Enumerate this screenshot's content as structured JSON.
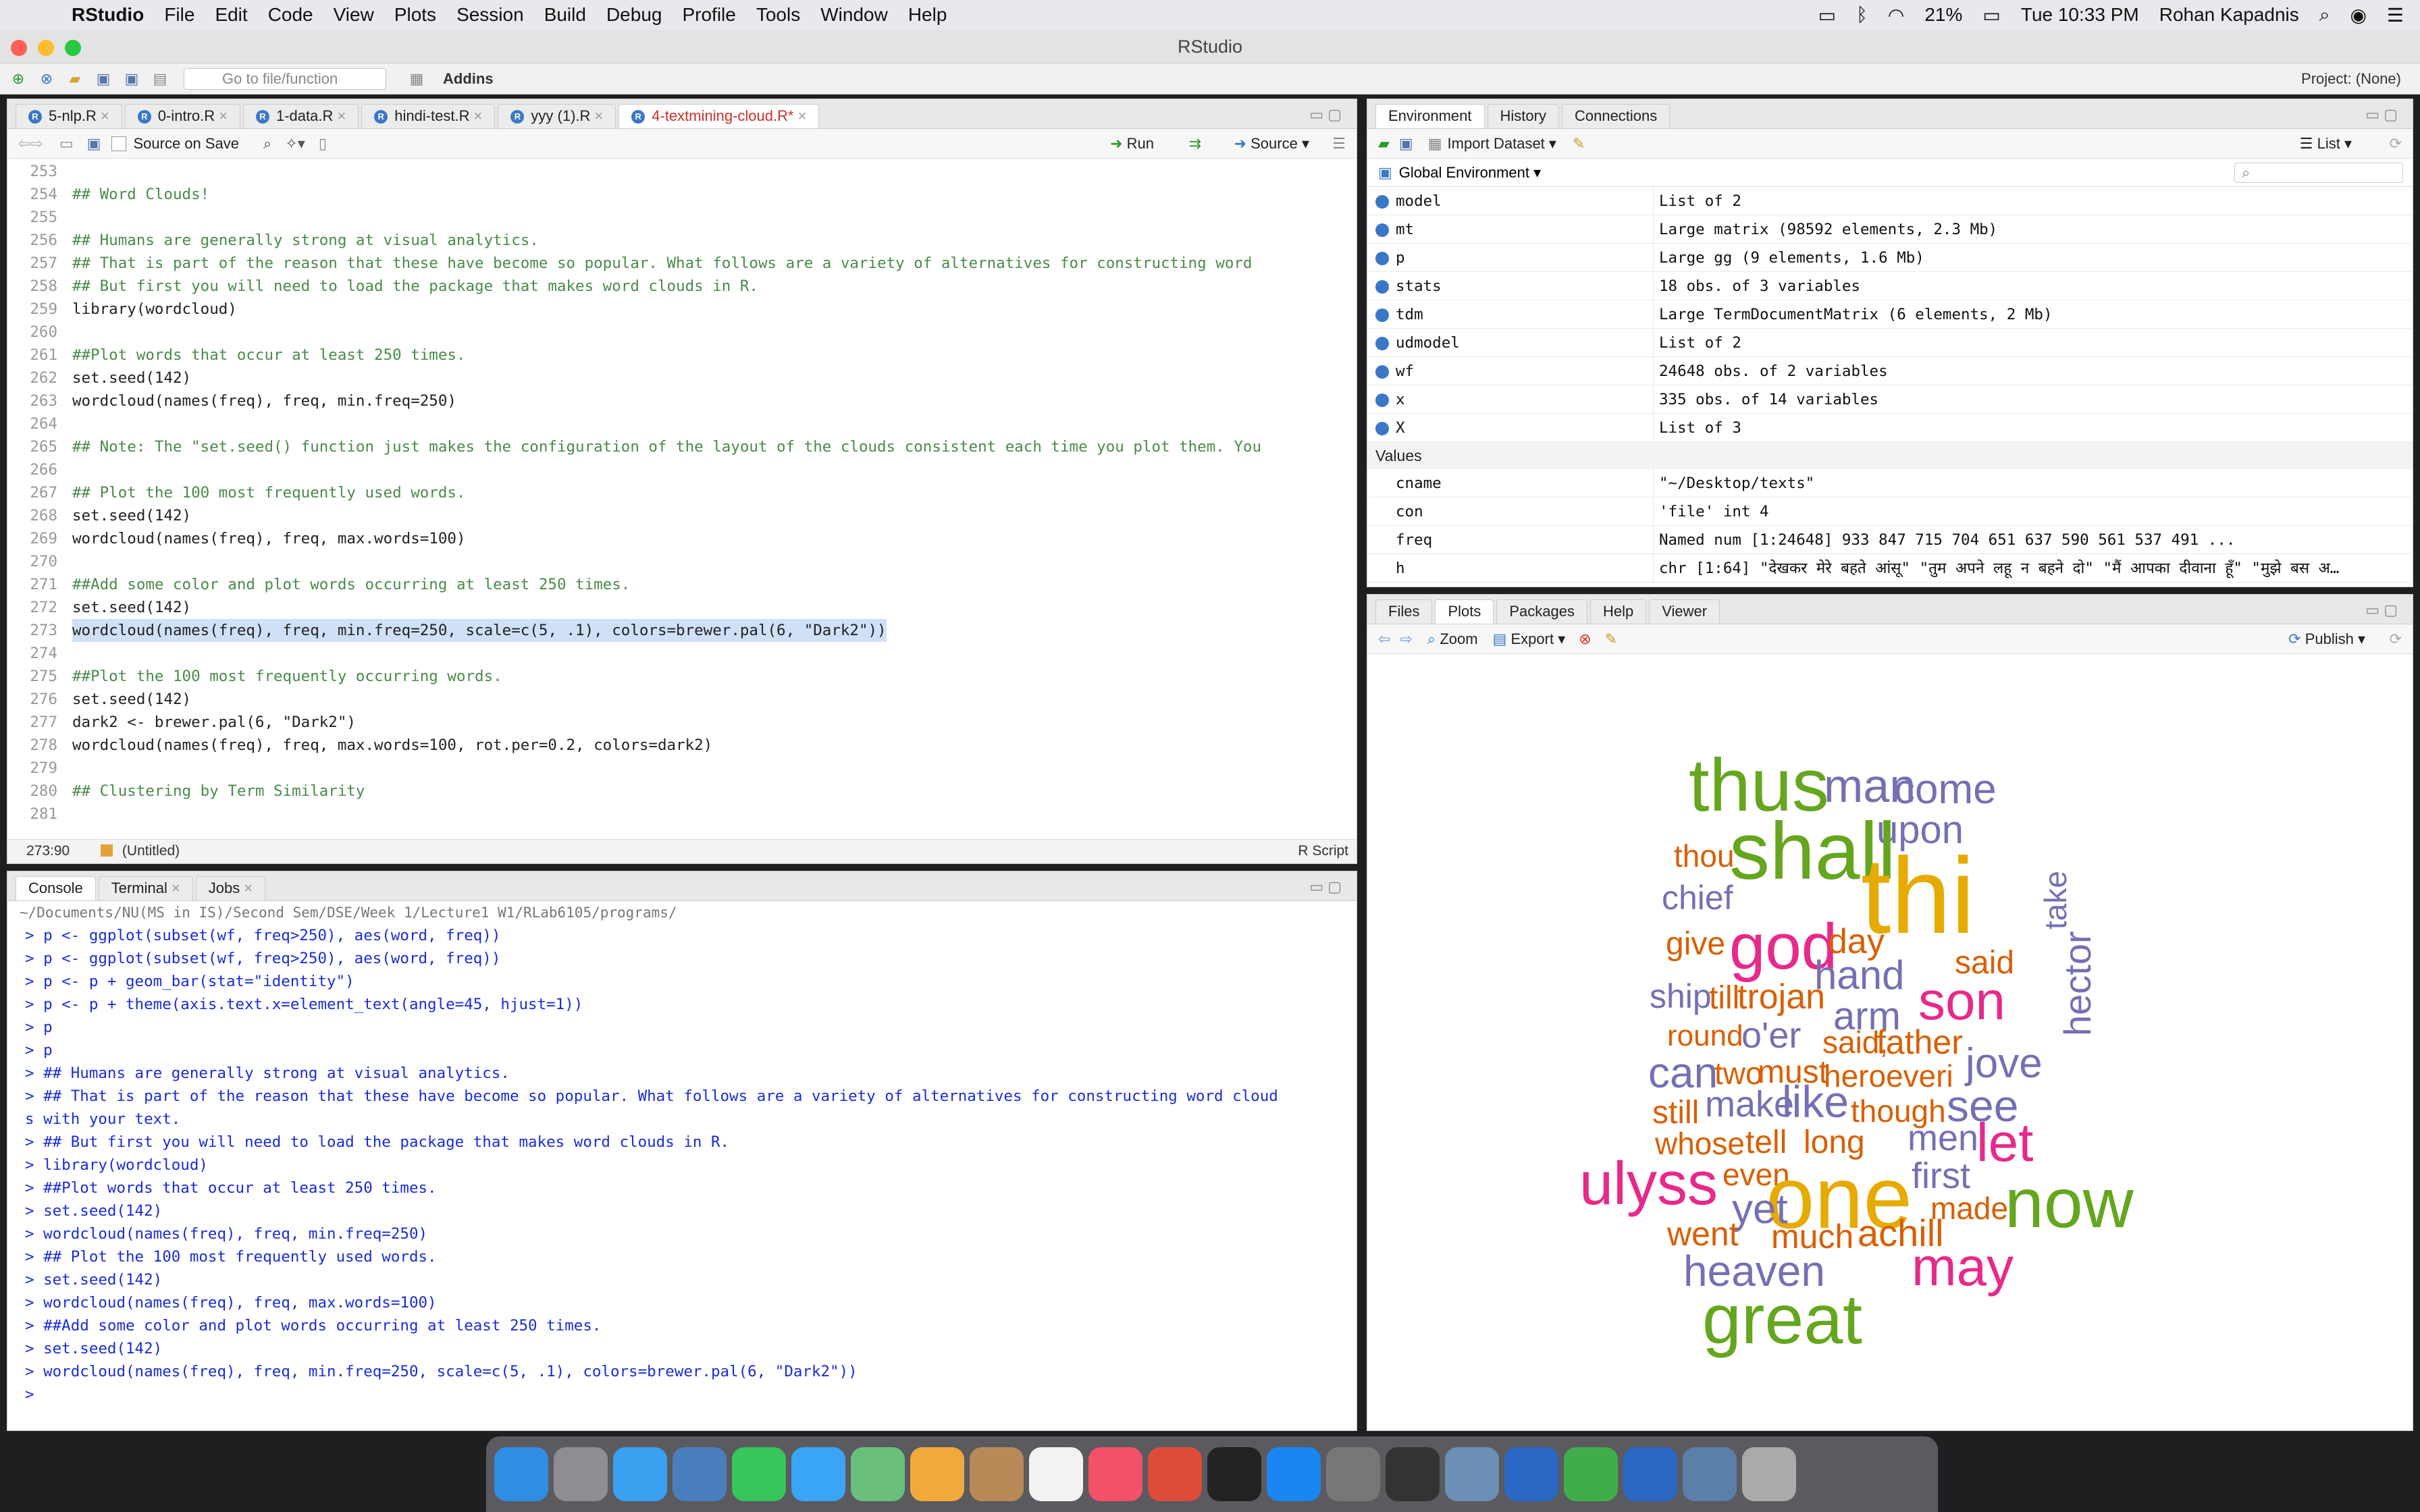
{
  "menubar": {
    "app": "RStudio",
    "items": [
      "File",
      "Edit",
      "Code",
      "View",
      "Plots",
      "Session",
      "Build",
      "Debug",
      "Profile",
      "Tools",
      "Window",
      "Help"
    ],
    "battery": "21%",
    "clock": "Tue 10:33 PM",
    "user": "Rohan Kapadnis"
  },
  "window": {
    "title": "RStudio"
  },
  "toolbar": {
    "goto_placeholder": "Go to file/function",
    "addins": "Addins",
    "project": "Project: (None)"
  },
  "editor": {
    "tabs": [
      "5-nlp.R",
      "0-intro.R",
      "1-data.R",
      "hindi-test.R",
      "yyy (1).R",
      "4-textmining-cloud.R*"
    ],
    "source_on_save": "Source on Save",
    "run": "Run",
    "source": "Source",
    "lines": [
      {
        "n": "253",
        "t": "",
        "c": false
      },
      {
        "n": "254",
        "t": "## Word Clouds!",
        "c": true
      },
      {
        "n": "255",
        "t": "",
        "c": false
      },
      {
        "n": "256",
        "t": "## Humans are generally strong at visual analytics.",
        "c": true
      },
      {
        "n": "257",
        "t": "## That is part of the reason that these have become so popular. What follows are a variety of alternatives for constructing word",
        "c": true
      },
      {
        "n": "258",
        "t": "## But first you will need to load the package that makes word clouds in R.",
        "c": true
      },
      {
        "n": "259",
        "t": "library(wordcloud)",
        "c": false
      },
      {
        "n": "260",
        "t": "",
        "c": false
      },
      {
        "n": "261",
        "t": "##Plot words that occur at least 250 times.",
        "c": true
      },
      {
        "n": "262",
        "t": "set.seed(142)",
        "c": false
      },
      {
        "n": "263",
        "t": "wordcloud(names(freq), freq, min.freq=250)",
        "c": false
      },
      {
        "n": "264",
        "t": "",
        "c": false
      },
      {
        "n": "265",
        "t": "## Note: The \"set.seed() function just makes the configuration of the layout of the clouds consistent each time you plot them. You",
        "c": true
      },
      {
        "n": "266",
        "t": "",
        "c": false
      },
      {
        "n": "267",
        "t": "## Plot the 100 most frequently used words.",
        "c": true
      },
      {
        "n": "268",
        "t": "set.seed(142)",
        "c": false
      },
      {
        "n": "269",
        "t": "wordcloud(names(freq), freq, max.words=100)",
        "c": false
      },
      {
        "n": "270",
        "t": "",
        "c": false
      },
      {
        "n": "271",
        "t": "##Add some color and plot words occurring at least 250 times.",
        "c": true
      },
      {
        "n": "272",
        "t": "set.seed(142)",
        "c": false
      },
      {
        "n": "273",
        "t": "wordcloud(names(freq), freq, min.freq=250, scale=c(5, .1), colors=brewer.pal(6, \"Dark2\"))",
        "c": false,
        "sel": true
      },
      {
        "n": "274",
        "t": "",
        "c": false
      },
      {
        "n": "275",
        "t": "##Plot the 100 most frequently occurring words.",
        "c": true
      },
      {
        "n": "276",
        "t": "set.seed(142)",
        "c": false
      },
      {
        "n": "277",
        "t": "dark2 <- brewer.pal(6, \"Dark2\")",
        "c": false
      },
      {
        "n": "278",
        "t": "wordcloud(names(freq), freq, max.words=100, rot.per=0.2, colors=dark2)",
        "c": false
      },
      {
        "n": "279",
        "t": "",
        "c": false
      },
      {
        "n": "280",
        "t": "## Clustering by Term Similarity",
        "c": true
      },
      {
        "n": "281",
        "t": "",
        "c": false
      }
    ],
    "status_pos": "273:90",
    "status_scope": "(Untitled)",
    "status_type": "R Script"
  },
  "console": {
    "tabs": [
      "Console",
      "Terminal",
      "Jobs"
    ],
    "path": "~/Documents/NU(MS in IS)/Second Sem/DSE/Week 1/Lecture1 W1/RLab6105/programs/",
    "lines": [
      "> p <- ggplot(subset(wf, freq>250), aes(word, freq))",
      "> p <- ggplot(subset(wf, freq>250), aes(word, freq))",
      "> p <- p + geom_bar(stat=\"identity\")",
      "> p <- p + theme(axis.text.x=element_text(angle=45, hjust=1))",
      "> p",
      "> p",
      "> ## Humans are generally strong at visual analytics.",
      "> ## That is part of the reason that these have become so popular. What follows are a variety of alternatives for constructing word cloud",
      "s with your text.",
      "> ## But first you will need to load the package that makes word clouds in R.",
      "> library(wordcloud)",
      "> ##Plot words that occur at least 250 times.",
      "> set.seed(142)",
      "> wordcloud(names(freq), freq, min.freq=250)",
      "> ## Plot the 100 most frequently used words.",
      "> set.seed(142)",
      "> wordcloud(names(freq), freq, max.words=100)",
      "> ##Add some color and plot words occurring at least 250 times.",
      "> set.seed(142)",
      "> wordcloud(names(freq), freq, min.freq=250, scale=c(5, .1), colors=brewer.pal(6, \"Dark2\"))",
      "> "
    ]
  },
  "environment": {
    "tabs": [
      "Environment",
      "History",
      "Connections"
    ],
    "import_dataset": "Import Dataset",
    "list_view": "List",
    "scope": "Global Environment",
    "data": [
      {
        "name": "model",
        "value": "List of 2"
      },
      {
        "name": "mt",
        "value": "Large matrix (98592 elements, 2.3 Mb)"
      },
      {
        "name": "p",
        "value": "Large gg (9 elements, 1.6 Mb)"
      },
      {
        "name": "stats",
        "value": "18 obs. of 3 variables"
      },
      {
        "name": "tdm",
        "value": "Large TermDocumentMatrix (6 elements, 2 Mb)"
      },
      {
        "name": "udmodel",
        "value": "List of 2"
      },
      {
        "name": "wf",
        "value": "24648 obs. of 2 variables"
      },
      {
        "name": "x",
        "value": "335 obs. of 14 variables"
      },
      {
        "name": "X",
        "value": "List of 3"
      }
    ],
    "values_header": "Values",
    "values": [
      {
        "name": "cname",
        "value": "\"~/Desktop/texts\""
      },
      {
        "name": "con",
        "value": "'file' int 4"
      },
      {
        "name": "freq",
        "value": "Named num [1:24648] 933 847 715 704 651 637 590 561 537 491 ..."
      },
      {
        "name": "h",
        "value": "chr [1:64] \"देखकर मेरे बहते आंसू\" \"तुम अपने लहू न बहने दो\" \"मैं आपका दीवाना हूँ\" \"मुझे बस अ…"
      }
    ]
  },
  "plots": {
    "tabs": [
      "Files",
      "Plots",
      "Packages",
      "Help",
      "Viewer"
    ],
    "zoom": "Zoom",
    "export": "Export",
    "publish": "Publish",
    "colors": {
      "green": "#66a61e",
      "gold": "#e6ab02",
      "pink": "#e7298a",
      "purple": "#7570b3",
      "orange": "#d95f02",
      "brown": "#a6761d"
    },
    "words": [
      {
        "t": "thus",
        "s": 110,
        "c": "green"
      },
      {
        "t": "man",
        "s": 70,
        "c": "purple"
      },
      {
        "t": "come",
        "s": 62,
        "c": "purple"
      },
      {
        "t": "upon",
        "s": 58,
        "c": "purple"
      },
      {
        "t": "shall",
        "s": 120,
        "c": "green"
      },
      {
        "t": "thou",
        "s": 46,
        "c": "orange"
      },
      {
        "t": "chief",
        "s": 50,
        "c": "purple"
      },
      {
        "t": "thi",
        "s": 160,
        "c": "gold"
      },
      {
        "t": "take",
        "s": 46,
        "c": "purple",
        "r": true
      },
      {
        "t": "give",
        "s": 48,
        "c": "orange"
      },
      {
        "t": "god",
        "s": 96,
        "c": "pink"
      },
      {
        "t": "day",
        "s": 52,
        "c": "orange"
      },
      {
        "t": "hand",
        "s": 60,
        "c": "purple"
      },
      {
        "t": "said",
        "s": 48,
        "c": "orange"
      },
      {
        "t": "ship",
        "s": 50,
        "c": "purple"
      },
      {
        "t": "till",
        "s": 48,
        "c": "orange"
      },
      {
        "t": "trojan",
        "s": 52,
        "c": "orange"
      },
      {
        "t": "arm",
        "s": 58,
        "c": "purple"
      },
      {
        "t": "son",
        "s": 80,
        "c": "pink"
      },
      {
        "t": "hector",
        "s": 56,
        "c": "purple",
        "r": true
      },
      {
        "t": "round",
        "s": 44,
        "c": "orange"
      },
      {
        "t": "o'er",
        "s": 54,
        "c": "purple"
      },
      {
        "t": "said,",
        "s": 46,
        "c": "orange"
      },
      {
        "t": "father",
        "s": 50,
        "c": "orange"
      },
      {
        "t": "can",
        "s": 64,
        "c": "purple"
      },
      {
        "t": "two",
        "s": 46,
        "c": "orange"
      },
      {
        "t": "must",
        "s": 48,
        "c": "orange"
      },
      {
        "t": "heroeveri",
        "s": 46,
        "c": "orange"
      },
      {
        "t": "jove",
        "s": 62,
        "c": "purple"
      },
      {
        "t": "still",
        "s": 48,
        "c": "orange"
      },
      {
        "t": "make",
        "s": 54,
        "c": "purple"
      },
      {
        "t": "like",
        "s": 66,
        "c": "purple"
      },
      {
        "t": "though",
        "s": 46,
        "c": "orange"
      },
      {
        "t": "see",
        "s": 66,
        "c": "purple"
      },
      {
        "t": "whose",
        "s": 46,
        "c": "orange"
      },
      {
        "t": "tell",
        "s": 48,
        "c": "orange"
      },
      {
        "t": "long",
        "s": 48,
        "c": "orange"
      },
      {
        "t": "men",
        "s": 54,
        "c": "purple"
      },
      {
        "t": "let",
        "s": 80,
        "c": "pink"
      },
      {
        "t": "even",
        "s": 46,
        "c": "orange"
      },
      {
        "t": "first",
        "s": 54,
        "c": "purple"
      },
      {
        "t": "ulyss",
        "s": 90,
        "c": "pink"
      },
      {
        "t": "one",
        "s": 130,
        "c": "gold"
      },
      {
        "t": "now",
        "s": 104,
        "c": "green"
      },
      {
        "t": "yet",
        "s": 62,
        "c": "purple"
      },
      {
        "t": "made",
        "s": 46,
        "c": "orange"
      },
      {
        "t": "went",
        "s": 50,
        "c": "orange"
      },
      {
        "t": "much",
        "s": 50,
        "c": "orange"
      },
      {
        "t": "achill",
        "s": 56,
        "c": "orange"
      },
      {
        "t": "heaven",
        "s": 64,
        "c": "purple"
      },
      {
        "t": "may",
        "s": 80,
        "c": "pink"
      },
      {
        "t": "great",
        "s": 104,
        "c": "green"
      }
    ]
  },
  "dock": [
    "Finder",
    "Launchpad",
    "Safari",
    "Preview",
    "FaceTime",
    "Messages",
    "Maps",
    "Photos",
    "Contacts",
    "Calendar",
    "Music",
    "Chrome",
    "TV",
    "App Store",
    "System Preferences",
    "Terminal",
    "Preview",
    "R",
    "RStudio",
    "R",
    "Downloads",
    "Trash"
  ]
}
